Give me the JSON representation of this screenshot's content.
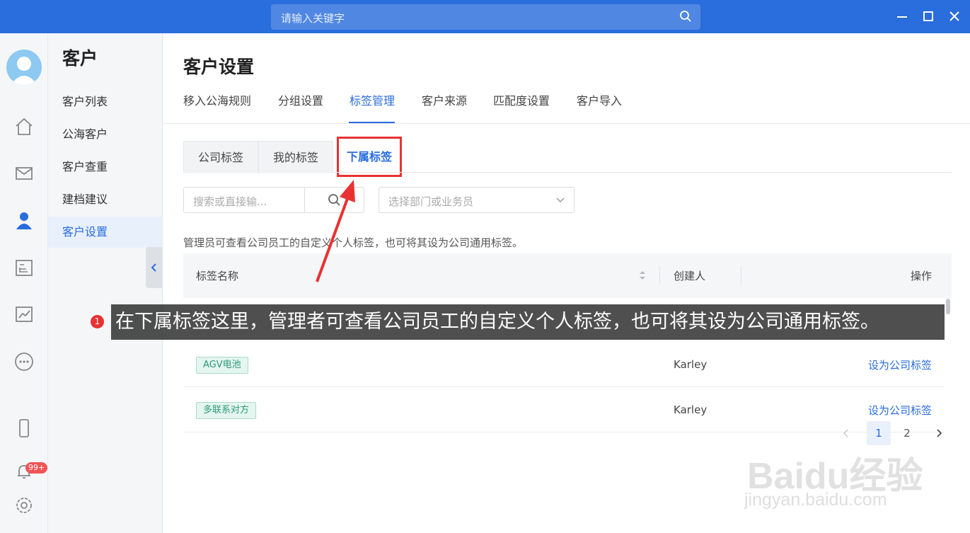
{
  "titlebar": {
    "search_placeholder": "请输入关键字"
  },
  "submenu": {
    "title": "客户",
    "items": [
      {
        "label": "客户列表"
      },
      {
        "label": "公海客户"
      },
      {
        "label": "客户查重"
      },
      {
        "label": "建档建议"
      },
      {
        "label": "客户设置"
      }
    ],
    "active_index": 4
  },
  "rail": {
    "notification_badge": "99+"
  },
  "main": {
    "page_title": "客户设置",
    "tabs": [
      {
        "label": "移入公海规则"
      },
      {
        "label": "分组设置"
      },
      {
        "label": "标签管理"
      },
      {
        "label": "客户来源"
      },
      {
        "label": "匹配度设置"
      },
      {
        "label": "客户导入"
      }
    ],
    "active_tab": 2,
    "subtabs": [
      {
        "label": "公司标签"
      },
      {
        "label": "我的标签"
      },
      {
        "label": "下属标签"
      }
    ],
    "active_subtab": 2,
    "search_placeholder": "搜索或直接输...",
    "select_placeholder": "选择部门或业务员",
    "hint": "管理员可查看公司员工的自定义个人标签，也可将其设为公司通用标签。",
    "table": {
      "headers": {
        "name": "标签名称",
        "creator": "创建人",
        "action": "操作"
      },
      "rows": [
        {
          "tag": "AGV电池",
          "creator": "Karley",
          "action": "设为公司标签"
        },
        {
          "tag": "多联系对方",
          "creator": "Karley",
          "action": "设为公司标签"
        }
      ]
    },
    "pagination": {
      "pages": [
        "1",
        "2"
      ],
      "current": "1"
    }
  },
  "overlay": {
    "step": "1",
    "caption": "在下属标签这里，管理者可查看公司员工的自定义个人标签，也可将其设为公司通用标签。"
  },
  "watermark": {
    "brand": "Baidu经验",
    "url": "jingyan.baidu.com"
  },
  "colors": {
    "primary": "#2a6ddc",
    "highlight": "#e83232",
    "tag_text": "#2a9a7a"
  }
}
